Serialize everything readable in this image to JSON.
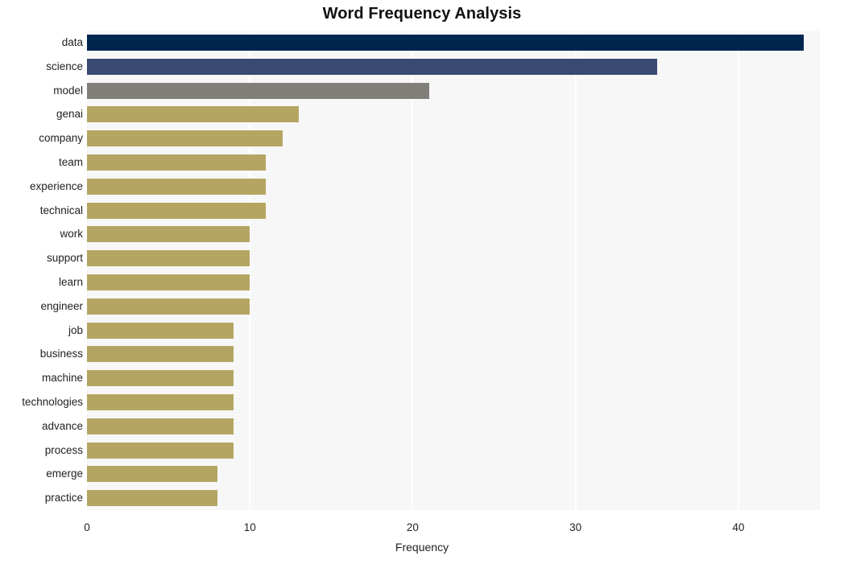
{
  "chart_data": {
    "type": "bar",
    "orientation": "horizontal",
    "title": "Word Frequency Analysis",
    "xlabel": "Frequency",
    "ylabel": "",
    "categories": [
      "data",
      "science",
      "model",
      "genai",
      "company",
      "team",
      "experience",
      "technical",
      "work",
      "support",
      "learn",
      "engineer",
      "job",
      "business",
      "machine",
      "technologies",
      "advance",
      "process",
      "emerge",
      "practice"
    ],
    "values": [
      44,
      35,
      21,
      13,
      12,
      11,
      11,
      11,
      10,
      10,
      10,
      10,
      9,
      9,
      9,
      9,
      9,
      9,
      8,
      8
    ],
    "bar_colors": [
      "#00254f",
      "#394a72",
      "#827f7b",
      "#b4a563",
      "#b4a563",
      "#b4a563",
      "#b4a563",
      "#b4a563",
      "#b4a563",
      "#b4a563",
      "#b4a563",
      "#b4a563",
      "#b4a563",
      "#b4a563",
      "#b4a563",
      "#b4a563",
      "#b4a563",
      "#b4a563",
      "#b4a563",
      "#b4a563"
    ],
    "xlim": [
      0,
      45
    ],
    "xticks": [
      0,
      10,
      20,
      30,
      40
    ],
    "xtick_labels": [
      "0",
      "10",
      "20",
      "30",
      "40"
    ],
    "grid": true,
    "grid_color": "#ffffff",
    "plot_background": "#f7f7f7",
    "figure_background": "#ffffff",
    "legend": null
  },
  "theme": {
    "title_color": "#111111",
    "tick_color": "#222222"
  }
}
